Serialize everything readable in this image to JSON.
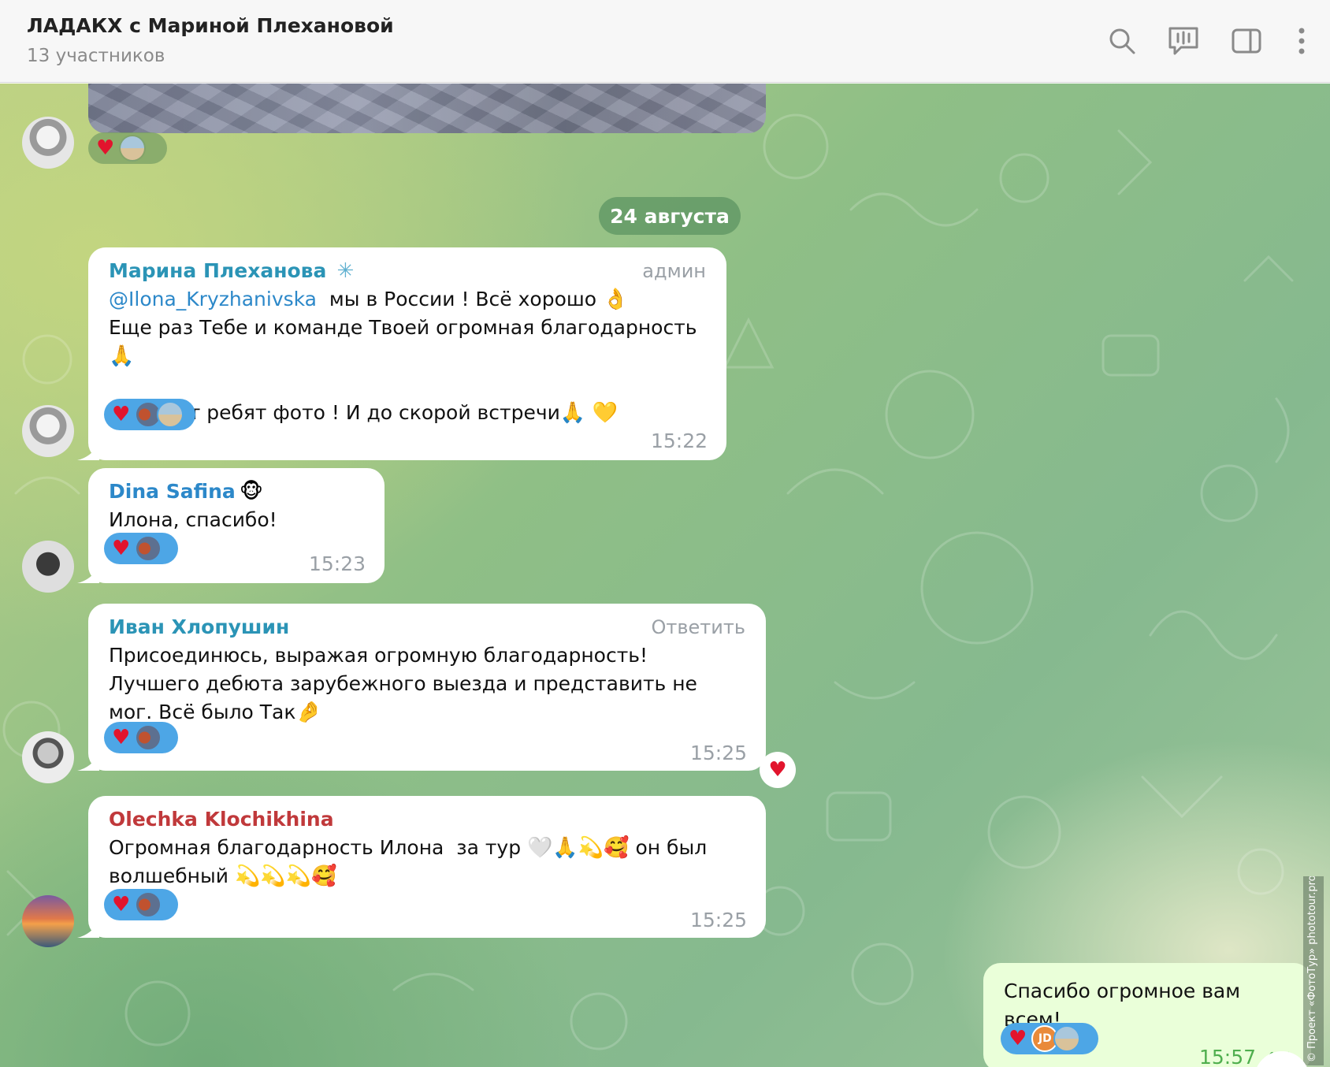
{
  "header": {
    "title": "ЛАДАКХ с Мариной Плехановой",
    "subtitle": "13 участников",
    "icons": [
      "search-icon",
      "video-chat-icon",
      "sidebar-toggle-icon",
      "more-icon"
    ]
  },
  "date_separator": "24 августа",
  "messages": [
    {
      "sender": "Марина Плехановa",
      "sender_full": "Марина Плеханова",
      "sender_color": "#2b94b6",
      "badge": "админ",
      "mention": "@Ilona_Kryzhanivska",
      "line1_rest": "  мы в России ! Всё хорошо ",
      "line1_emoji": "👌",
      "line2": "Еще раз Тебе и команде Твоей огромная благодарность ",
      "line2_emoji": "🙏",
      "line3": "Ждём от ребят фото ! И до скорой встречи",
      "line3_emoji": "🙏 💛",
      "time": "15:22"
    },
    {
      "sender": "Dina Safina",
      "sender_color": "#2c88c9",
      "sender_emoji": "🐵",
      "text": "Илона, спасибо!",
      "time": "15:23"
    },
    {
      "sender": "Иван Хлопушин",
      "sender_color": "#2b94b6",
      "action": "Ответить",
      "text": "Присоединюсь, выражая огромную благодарность! Лучшего дебюта зарубежного выезда и представить не мог. Всё было Так",
      "text_emoji": "🤌",
      "time": "15:25"
    },
    {
      "sender": "Olechka Klochikhina",
      "sender_color": "#c0393b",
      "line1": "Огромная благодарность Илона  за тур ",
      "line1_emoji": "🤍🙏💫🥰",
      "line1_rest": " он был",
      "line2": "волшебный ",
      "line2_emoji": "💫💫💫🥰",
      "time": "15:25"
    },
    {
      "text": "Спасибо огромное вам всем!",
      "time": "15:57",
      "reaction_initials": "JD"
    }
  ],
  "reaction": {
    "heart": "♥"
  },
  "watermark": "© Проект «ФотоТур» phototour.pro",
  "colors": {
    "header_bg": "#f7f7f7",
    "bubble_in": "#ffffff",
    "bubble_out": "#eaffd9",
    "reaction_pill": "#4da6e6",
    "heart": "#e2142d"
  }
}
